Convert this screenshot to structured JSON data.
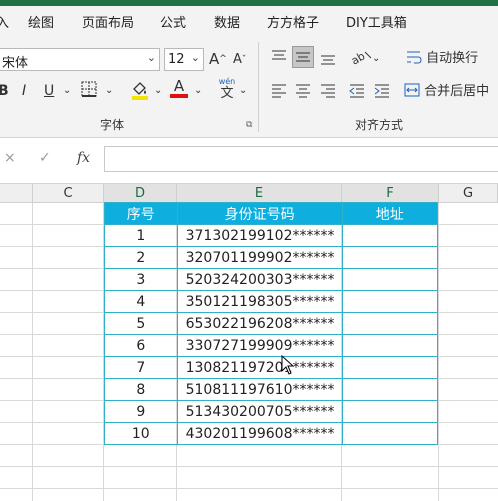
{
  "menu": {
    "items": [
      "入",
      "绘图",
      "页面布局",
      "公式",
      "数据",
      "方方格子",
      "DIY工具箱"
    ]
  },
  "ribbon": {
    "font_name": "宋体",
    "font_size": "12",
    "grow": "A",
    "shrink": "A",
    "bold": "B",
    "italic": "I",
    "underline": "U",
    "font_color_letter": "A",
    "wen": "wén",
    "wen_char": "文",
    "font_group_label": "字体",
    "wrap_text": "自动换行",
    "merge_center": "合并后居中",
    "align_group_label": "对齐方式",
    "accent_highlight": "#f5e400",
    "accent_fontcolor": "#e01010"
  },
  "formula_bar": {
    "cancel": "×",
    "enter": "✓",
    "fx": "fx",
    "value": ""
  },
  "columns": [
    "C",
    "D",
    "E",
    "F",
    "G"
  ],
  "table": {
    "headers": [
      "序号",
      "身份证号码",
      "地址"
    ],
    "header_color": "#0eaede",
    "rows": [
      [
        "1",
        "371302199102******",
        ""
      ],
      [
        "2",
        "320701199902******",
        ""
      ],
      [
        "3",
        "520324200303******",
        ""
      ],
      [
        "4",
        "350121198305******",
        ""
      ],
      [
        "5",
        "653022196208******",
        ""
      ],
      [
        "6",
        "330727199909******",
        ""
      ],
      [
        "7",
        "130821197201******",
        ""
      ],
      [
        "8",
        "510811197610******",
        ""
      ],
      [
        "9",
        "513430200705******",
        ""
      ],
      [
        "10",
        "430201199608******",
        ""
      ]
    ]
  }
}
